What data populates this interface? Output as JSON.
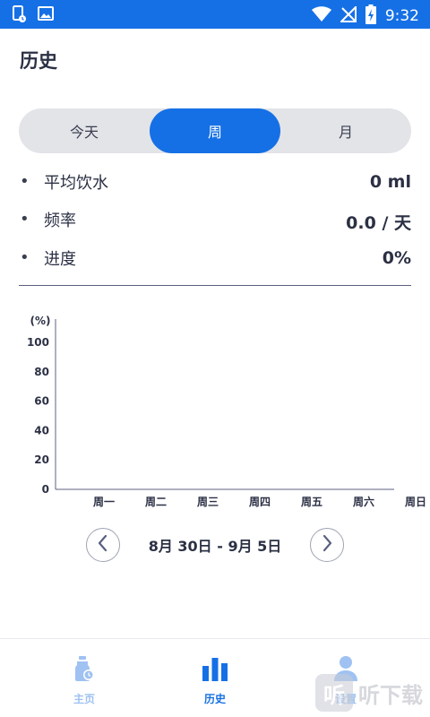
{
  "status_bar": {
    "time": "9:32",
    "icons": [
      "sim-card-icon",
      "image-icon",
      "wifi-icon",
      "no-sim-icon",
      "battery-charging-icon"
    ]
  },
  "header": {
    "title": "历史"
  },
  "period_tabs": [
    {
      "label": "今天",
      "selected": false
    },
    {
      "label": "周",
      "selected": true
    },
    {
      "label": "月",
      "selected": false
    }
  ],
  "stats": [
    {
      "label": "平均饮水",
      "value": "0 ml"
    },
    {
      "label": "频率",
      "value": "0.0 / 天"
    },
    {
      "label": "进度",
      "value": "0%"
    }
  ],
  "chart_data": {
    "type": "bar",
    "title": "",
    "ylabel": "(%)",
    "xlabel": "",
    "categories": [
      "周一",
      "周二",
      "周三",
      "周四",
      "周五",
      "周六",
      "周日"
    ],
    "values": [
      0,
      0,
      0,
      0,
      0,
      0,
      0
    ],
    "yticks": [
      "100",
      "80",
      "60",
      "40",
      "20",
      "0"
    ],
    "ylim": [
      0,
      100
    ],
    "grid": false
  },
  "date_nav": {
    "range": "8月 30日 - 9月 5日",
    "prev_icon": "chevron-left-icon",
    "next_icon": "chevron-right-icon"
  },
  "bottom_nav": [
    {
      "label": "主页",
      "icon": "water-bottle-icon",
      "active": false
    },
    {
      "label": "历史",
      "icon": "bar-chart-icon",
      "active": true
    },
    {
      "label": "设置",
      "icon": "user-icon",
      "active": false
    }
  ],
  "watermark": {
    "text": "听下载",
    "mark": "听"
  },
  "colors": {
    "accent": "#1670e5",
    "inactive_nav": "#9fc2f2",
    "text": "#2b3044"
  }
}
